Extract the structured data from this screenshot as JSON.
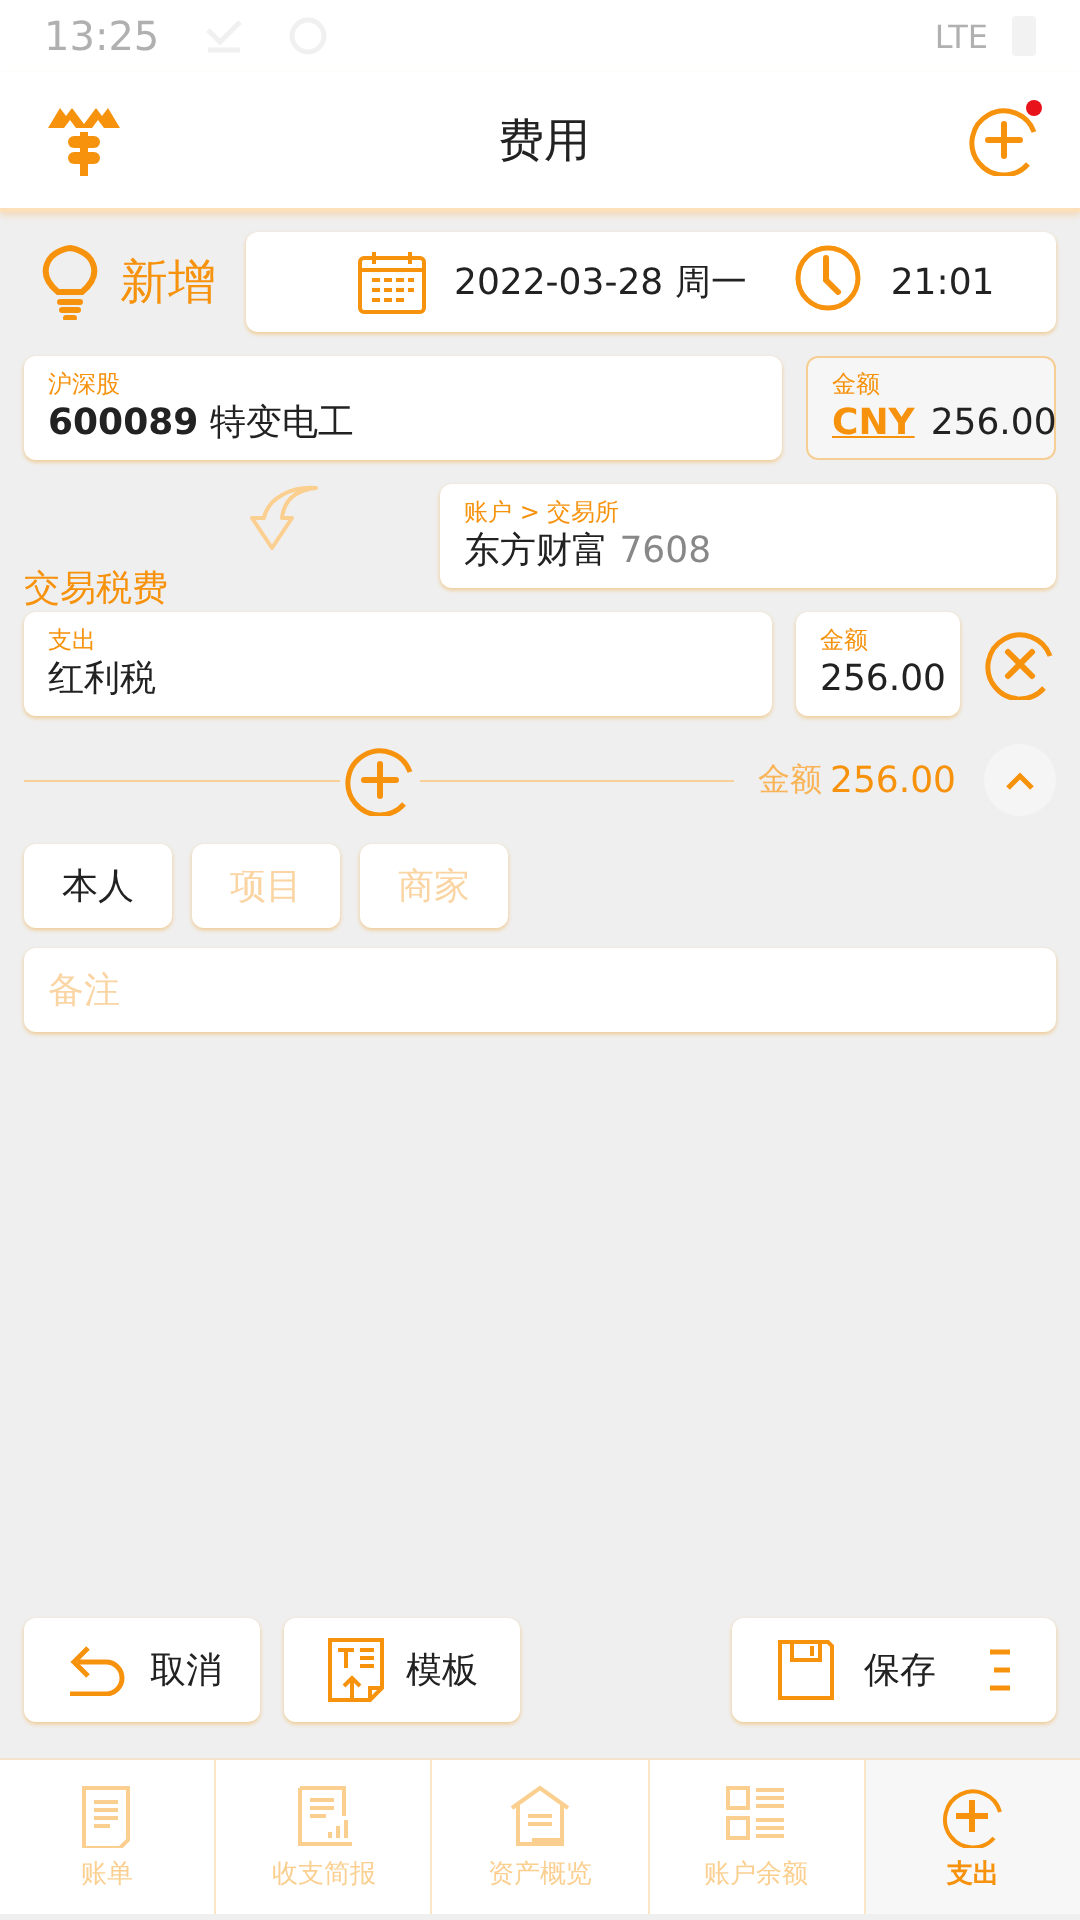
{
  "status_bar": {
    "time": "13:25",
    "network": "LTE"
  },
  "header": {
    "title": "费用",
    "notification": true
  },
  "mode": "新增",
  "date": "2022-03-28 周一",
  "time": "21:01",
  "security": {
    "label": "沪深股",
    "value": "**600089** 特变电工"
  },
  "amount": {
    "label": "金额",
    "currency": "CNY",
    "value": "256.00"
  },
  "account": {
    "label": "账户 > 交易所",
    "name": "东方财富",
    "number": "7608"
  },
  "section_title": "交易税费",
  "fees": [
    {
      "label": "支出",
      "value": "红利税",
      "amount_label": "金额",
      "amount": "256.00"
    }
  ],
  "total": {
    "label": "金额",
    "value": "256.00",
    "expanded": true
  },
  "tags": [
    {
      "value": "本人"
    },
    {
      "placeholder": "项目"
    },
    {
      "placeholder": "商家"
    }
  ],
  "note": {
    "placeholder": "备注"
  },
  "actions": [
    {
      "kind": "cancel",
      "label": "取消"
    },
    {
      "kind": "template",
      "label": "模板"
    },
    {
      "kind": "save",
      "label": "保存"
    }
  ],
  "tabs": [
    {
      "kind": "bill",
      "label": "账单",
      "selected": false
    },
    {
      "kind": "report",
      "label": "收支简报",
      "selected": false
    },
    {
      "kind": "assets",
      "label": "资产概览",
      "selected": false
    },
    {
      "kind": "balance",
      "label": "账户余额",
      "selected": false
    },
    {
      "kind": "expense",
      "label": "支出",
      "selected": true
    }
  ]
}
